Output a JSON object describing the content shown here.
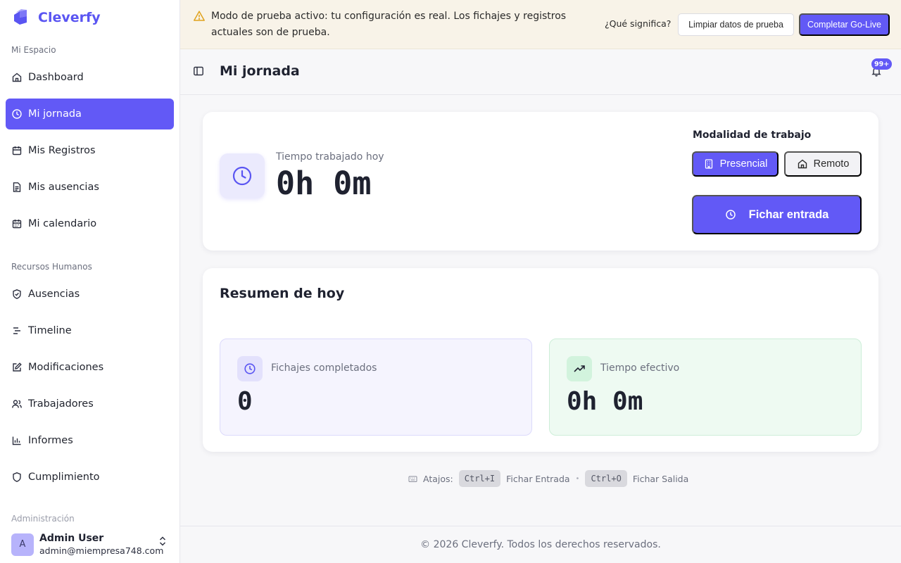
{
  "app": {
    "name": "Cleverfy"
  },
  "colors": {
    "accent": "#6259f6",
    "banner_bg": "#f8f3e8",
    "success_bg": "#eefaf2"
  },
  "sidebar": {
    "sections": [
      {
        "label": "Mi Espacio",
        "items": [
          {
            "label": "Dashboard",
            "icon": "home-icon",
            "active": false
          },
          {
            "label": "Mi jornada",
            "icon": "clock-icon",
            "active": true
          },
          {
            "label": "Mis Registros",
            "icon": "calendar-icon",
            "active": false
          },
          {
            "label": "Mis ausencias",
            "icon": "document-icon",
            "active": false
          },
          {
            "label": "Mi calendario",
            "icon": "calendar-grid-icon",
            "active": false
          }
        ]
      },
      {
        "label": "Recursos Humanos",
        "items": [
          {
            "label": "Ausencias",
            "icon": "shield-check-icon",
            "active": false
          },
          {
            "label": "Timeline",
            "icon": "timeline-icon",
            "active": false
          },
          {
            "label": "Modificaciones",
            "icon": "edit-icon",
            "active": false
          },
          {
            "label": "Trabajadores",
            "icon": "users-icon",
            "active": false
          },
          {
            "label": "Informes",
            "icon": "bar-chart-icon",
            "active": false
          },
          {
            "label": "Cumplimiento",
            "icon": "shield-icon",
            "active": false
          }
        ]
      }
    ],
    "next_section_partial": "Administración",
    "user": {
      "initial": "A",
      "name": "Admin User",
      "email": "admin@miempresa748.com"
    }
  },
  "banner": {
    "text": "Modo de prueba activo: tu configuración es real. Los fichajes y registros actuales son de prueba.",
    "link": "¿Qué significa?",
    "clear_button": "Limpiar datos de prueba",
    "golive_button": "Completar Go-Live"
  },
  "header": {
    "title": "Mi jornada",
    "notifications_badge": "99+"
  },
  "work": {
    "time_label": "Tiempo trabajado hoy",
    "time_value": "0h 0m",
    "modality_label": "Modalidad de trabajo",
    "modality_options": [
      "Presencial",
      "Remoto"
    ],
    "modality_selected": "Presencial",
    "clock_in_button": "Fichar entrada"
  },
  "summary": {
    "title": "Resumen de hoy",
    "stats": [
      {
        "label": "Fichajes completados",
        "value": "0",
        "icon": "clock-icon"
      },
      {
        "label": "Tiempo efectivo",
        "value": "0h 0m",
        "icon": "trending-up-icon"
      }
    ]
  },
  "shortcuts": {
    "label": "Atajos:",
    "items": [
      {
        "keys": "Ctrl+I",
        "action": "Fichar Entrada"
      },
      {
        "keys": "Ctrl+O",
        "action": "Fichar Salida"
      }
    ]
  },
  "footer": {
    "text": "© 2026 Cleverfy. Todos los derechos reservados."
  }
}
